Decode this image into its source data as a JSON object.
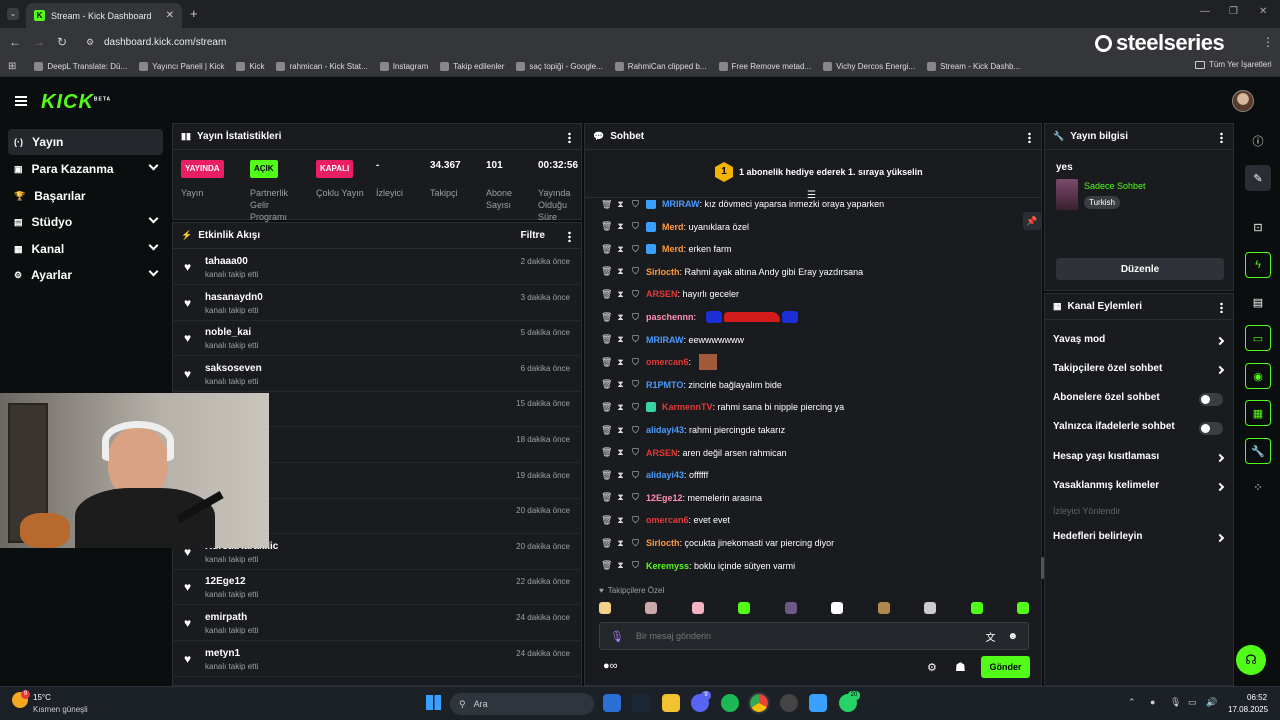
{
  "browser": {
    "tab_title": "Stream - Kick Dashboard",
    "url": "dashboard.kick.com/stream",
    "steelseries": "steelseries",
    "bookmarks": [
      "DeepL Translate: Dü...",
      "Yayıncı Paneli | Kick",
      "Kick",
      "rahmican - Kick Stat...",
      "Instagram",
      "Takip edilenler",
      "saç topiği - Google...",
      "RahmiCan clipped b...",
      "Free Remove metad...",
      "Vichy Dercos Energi...",
      "Stream - Kick Dashb..."
    ],
    "all_bookmarks": "Tüm Yer İşaretleri"
  },
  "kick": {
    "logo": "KICK",
    "beta": "BETA"
  },
  "sidebar": {
    "items": [
      {
        "label": "Yayın",
        "icon": "(·)"
      },
      {
        "label": "Para Kazanma",
        "icon": "▣"
      },
      {
        "label": "Başarılar",
        "icon": "🏆"
      },
      {
        "label": "Stüdyo",
        "icon": "▤"
      },
      {
        "label": "Kanal",
        "icon": "▦"
      },
      {
        "label": "Ayarlar",
        "icon": "⚙"
      }
    ]
  },
  "stats": {
    "title": "Yayın İstatistikleri",
    "items": [
      {
        "value": "YAYINDA",
        "label": "Yayın",
        "badge": "#e91e63"
      },
      {
        "value": "AÇIK",
        "label": "Partnerlik Gelir Programı",
        "badge": "#53fc18"
      },
      {
        "value": "KAPALI",
        "label": "Çoklu Yayın",
        "badge": "#e91e63"
      },
      {
        "value": "-",
        "label": "İzleyici",
        "badge": ""
      },
      {
        "value": "34.367",
        "label": "Takipçi",
        "badge": ""
      },
      {
        "value": "101",
        "label": "Abone Sayısı",
        "badge": ""
      },
      {
        "value": "00:32:56",
        "label": "Yayında Olduğu Süre",
        "badge": ""
      }
    ]
  },
  "activity": {
    "title": "Etkinlik Akışı",
    "filter": "Filtre",
    "events": [
      {
        "name": "tahaaa00",
        "sub": "kanalı takip etti",
        "time": "2 dakika önce"
      },
      {
        "name": "hasanaydn0",
        "sub": "kanalı takip etti",
        "time": "3 dakika önce"
      },
      {
        "name": "noble_kai",
        "sub": "kanalı takip etti",
        "time": "5 dakika önce"
      },
      {
        "name": "saksoseven",
        "sub": "kanalı takip etti",
        "time": "6 dakika önce"
      },
      {
        "name": "",
        "sub": "",
        "time": "15 dakika önce"
      },
      {
        "name": "usu",
        "sub": "",
        "time": "18 dakika önce"
      },
      {
        "name": "",
        "sub": "",
        "time": "19 dakika önce"
      },
      {
        "name": "",
        "sub": "",
        "time": "20 dakika önce"
      },
      {
        "name": "KursatKarakilic",
        "sub": "kanalı takip etti",
        "time": "20 dakika önce"
      },
      {
        "name": "12Ege12",
        "sub": "kanalı takip etti",
        "time": "22 dakika önce"
      },
      {
        "name": "emirpath",
        "sub": "kanalı takip etti",
        "time": "24 dakika önce"
      },
      {
        "name": "metyn1",
        "sub": "kanalı takip etti",
        "time": "24 dakika önce"
      }
    ]
  },
  "chat": {
    "title": "Sohbet",
    "banner": "1 abonelik hediye ederek 1. sıraya yükselin",
    "banner_num": "1",
    "messages": [
      {
        "user": "MRIRAW",
        "text": ": kız dövmeci yaparsa inmezki oraya yaparken",
        "color": "#4a9bff"
      },
      {
        "user": "Merd",
        "text": ": uyanıklara özel",
        "color": "#ff9a3c"
      },
      {
        "user": "Merd",
        "text": ": erken farm",
        "color": "#ff9a3c"
      },
      {
        "user": "Sirlocth",
        "text": ": Rahmi ayak altına Andy gibi Eray yazdırsana",
        "color": "#ff9a3c"
      },
      {
        "user": "ARSEN",
        "text": ": hayırlı geceler",
        "color": "#e53935"
      },
      {
        "user": "paschennn",
        "text": ":",
        "color": "#ff8fb1"
      },
      {
        "user": "MRIRAW",
        "text": ": eewwwwwww",
        "color": "#4a9bff"
      },
      {
        "user": "omercan6",
        "text": ":",
        "color": "#e53935"
      },
      {
        "user": "R1PMTO",
        "text": ": zincirle bağlayalım bide",
        "color": "#4a9bff"
      },
      {
        "user": "KarmennTV",
        "text": ": rahmi sana bi nipple piercing ya",
        "color": "#e53935"
      },
      {
        "user": "alidayi43",
        "text": ": rahmi piercingde takarız",
        "color": "#4a9bff"
      },
      {
        "user": "ARSEN",
        "text": ": aren değil arsen rahmican",
        "color": "#e53935"
      },
      {
        "user": "alidayi43",
        "text": ": offffff",
        "color": "#4a9bff"
      },
      {
        "user": "12Ege12",
        "text": ": memelerin arasına",
        "color": "#ff8fb1"
      },
      {
        "user": "omercan6",
        "text": ": evet evet",
        "color": "#e53935"
      },
      {
        "user": "Sirlocth",
        "text": ": çocukta jinekomasti var piercing diyor",
        "color": "#ff9a3c"
      },
      {
        "user": "Keremyss",
        "text": ": boklu içinde sütyen varmi",
        "color": "#53fc18"
      }
    ],
    "followers_only": "Takipçilere Özel",
    "placeholder": "Bir mesaj gönderin",
    "send": "Gönder"
  },
  "stream_info": {
    "title": "Yayın bilgisi",
    "stream_title": "yes",
    "category": "Sadece Sohbet",
    "tag": "Turkish",
    "edit": "Düzenle"
  },
  "channel_actions": {
    "title": "Kanal Eylemleri",
    "items": [
      "Yavaş mod",
      "Takipçilere özel sohbet",
      "Abonelere özel sohbet",
      "Yalnızca ifadelerle sohbet",
      "Hesap yaşı kısıtlaması",
      "Yasaklanmış kelimeler",
      "İzleyici Yönlendir",
      "Hedefleri belirleyin"
    ]
  },
  "taskbar": {
    "weather_temp": "15°C",
    "weather_desc": "Kısmen güneşli",
    "weather_badge": "9",
    "search": "Ara",
    "time": "06:52",
    "date": "17.08.2025",
    "whatsapp_badge": "20",
    "discord_badge": "9"
  }
}
